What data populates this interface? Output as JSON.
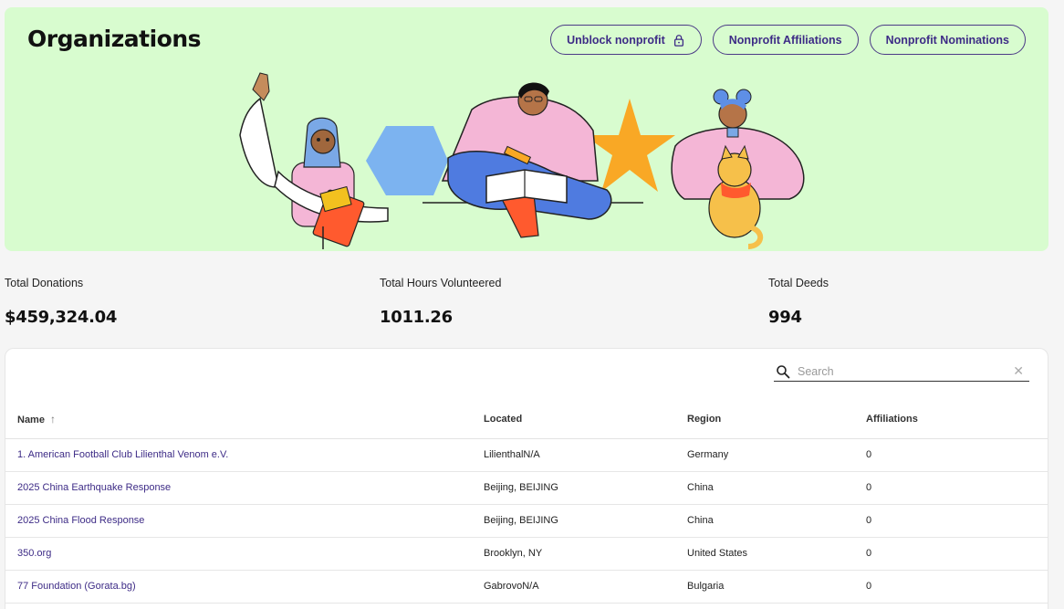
{
  "header": {
    "title": "Organizations",
    "actions": [
      {
        "label": "Unblock nonprofit",
        "icon": "lock-icon"
      },
      {
        "label": "Nonprofit Affiliations"
      },
      {
        "label": "Nonprofit Nominations"
      }
    ]
  },
  "stats": [
    {
      "label": "Total Donations",
      "value": "$459,324.04"
    },
    {
      "label": "Total Hours Volunteered",
      "value": "1011.26"
    },
    {
      "label": "Total Deeds",
      "value": "994"
    }
  ],
  "search": {
    "placeholder": "Search",
    "icon": "search-icon",
    "clear_icon": "close-icon"
  },
  "table": {
    "columns": [
      "Name",
      "Located",
      "Region",
      "Affiliations"
    ],
    "sort": {
      "column": "Name",
      "direction": "ascending"
    },
    "rows": [
      {
        "name": "1. American Football Club Lilienthal Venom e.V.",
        "located": "LilienthalN/A",
        "region": "Germany",
        "affiliations": "0"
      },
      {
        "name": "2025 China Earthquake Response",
        "located": "Beijing, BEIJING",
        "region": "China",
        "affiliations": "0"
      },
      {
        "name": "2025 China Flood Response",
        "located": "Beijing, BEIJING",
        "region": "China",
        "affiliations": "0"
      },
      {
        "name": "350.org",
        "located": "Brooklyn, NY",
        "region": "United States",
        "affiliations": "0"
      },
      {
        "name": "77 Foundation (Gorata.bg)",
        "located": "GabrovoN/A",
        "region": "Bulgaria",
        "affiliations": "0"
      }
    ]
  },
  "colors": {
    "hero_bg": "#d8fccf",
    "accent": "#3d2b86",
    "page_bg": "#f5f5f5"
  }
}
